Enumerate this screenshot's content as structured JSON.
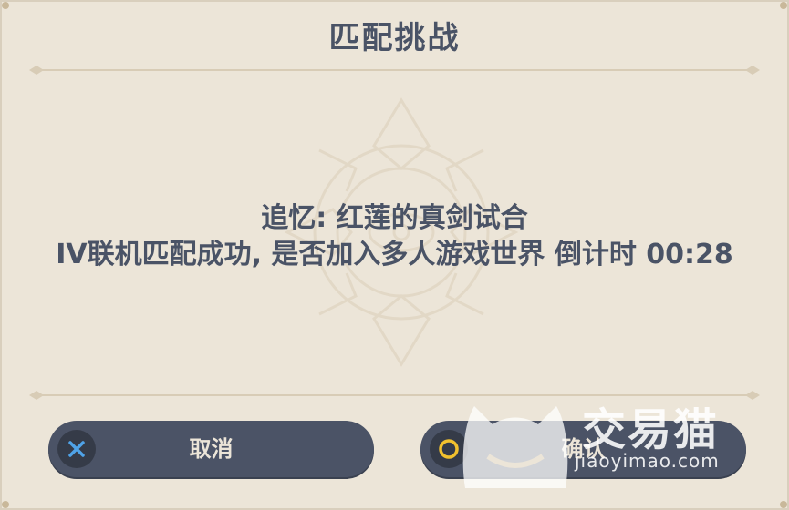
{
  "dialog": {
    "title": "匹配挑战",
    "message_line1": "追忆: 红莲的真剑试合",
    "message_line2": "IV联机匹配成功, 是否加入多人游戏世界 倒计时 00:28"
  },
  "buttons": {
    "cancel": {
      "label": "取消",
      "icon": "cross-icon",
      "icon_color": "#4fa3e8"
    },
    "confirm": {
      "label": "确认",
      "icon": "circle-icon",
      "icon_color": "#f2c12e"
    }
  },
  "watermark": {
    "brand": "交易猫",
    "url": "jiaoyimao.com"
  },
  "colors": {
    "background": "#ece5d8",
    "text": "#4a5366",
    "button": "#4b5366",
    "button_text": "#ece5d8"
  }
}
